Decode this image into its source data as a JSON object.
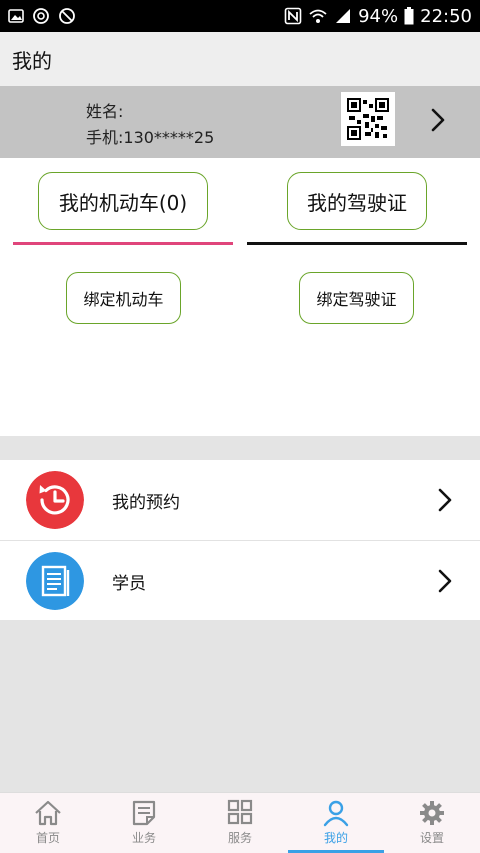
{
  "status_bar": {
    "battery": "94%",
    "time": "22:50",
    "icons": [
      "gallery-icon",
      "sync-icon",
      "blocked-icon",
      "nfc-icon",
      "wifi-icon",
      "signal-icon",
      "battery-icon"
    ]
  },
  "header": {
    "title": "我的"
  },
  "profile": {
    "name_label": "姓名:",
    "phone_label": "手机:130*****25",
    "qr_icon": "qr-code-icon"
  },
  "tabs": [
    {
      "label": "我的机动车(0)",
      "underline_color": "#e0457b"
    },
    {
      "label": "我的驾驶证",
      "underline_color": "#111111"
    }
  ],
  "actions": {
    "bind_vehicle": "绑定机动车",
    "bind_license": "绑定驾驶证"
  },
  "menu": [
    {
      "label": "我的预约",
      "icon": "history-clock-icon",
      "icon_color": "#e8373c"
    },
    {
      "label": "学员",
      "icon": "document-icon",
      "icon_color": "#2e97e2"
    }
  ],
  "bottom_nav": [
    {
      "label": "首页",
      "icon": "home-icon",
      "active": false
    },
    {
      "label": "业务",
      "icon": "business-icon",
      "active": false
    },
    {
      "label": "服务",
      "icon": "grid-icon",
      "active": false
    },
    {
      "label": "我的",
      "icon": "user-icon",
      "active": true
    },
    {
      "label": "设置",
      "icon": "gear-icon",
      "active": false
    }
  ],
  "colors": {
    "accent": "#3aa0e6",
    "pill_border": "#6aa52a",
    "profile_bg": "#c3c3c3"
  }
}
